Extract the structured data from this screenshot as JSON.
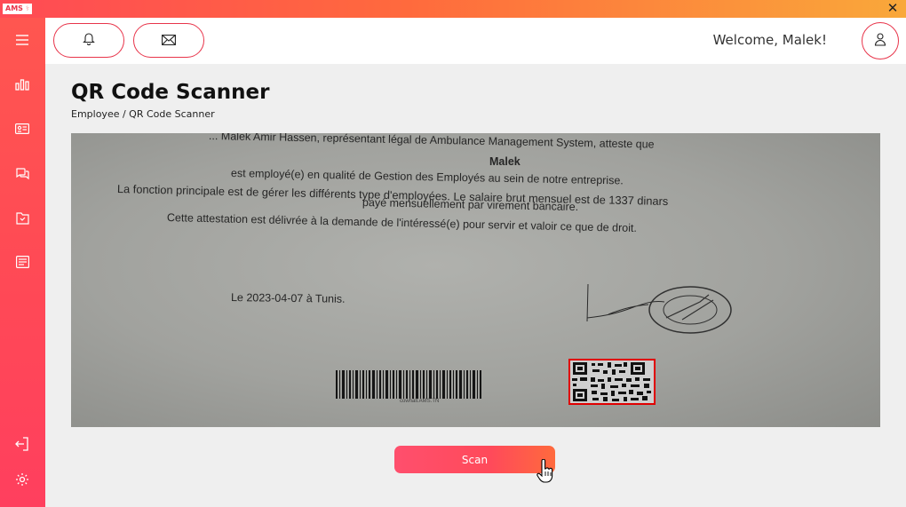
{
  "titlebar": {
    "logo_text": "AMS",
    "close_glyph": "✕"
  },
  "sidebar": {
    "items": [
      {
        "icon": "menu-icon"
      },
      {
        "icon": "chart-icon"
      },
      {
        "icon": "id-card-icon"
      },
      {
        "icon": "chat-icon"
      },
      {
        "icon": "folder-icon"
      },
      {
        "icon": "document-icon"
      },
      {
        "icon": "logout-icon"
      },
      {
        "icon": "gear-icon"
      }
    ]
  },
  "header": {
    "notification_icon": "bell-icon",
    "message_icon": "envelope-icon",
    "welcome_text": "Welcome, Malek!",
    "profile_icon": "user-icon"
  },
  "page": {
    "title": "QR Code Scanner",
    "breadcrumb": "Employee / QR Code Scanner"
  },
  "camera_view": {
    "lines": [
      "... Malek Amir Hassen, représentant légal de Ambulance Management System, atteste que",
      "Malek",
      "est employé(e) en qualité de Gestion des Employés au sein de notre entreprise.",
      "La fonction principale est de gérer les différents type d'employées. Le salaire brut mensuel est de 1337 dinars",
      "payé mensuellement par virement bancaire.",
      "Cette attestation est délivrée à la demande de l'intéressé(e) pour servir et valoir ce que de droit.",
      "Le 2023-04-07 à Tunis."
    ],
    "barcode_caption": "cowhall.AMS.TN"
  },
  "scan_button": {
    "label": "Scan"
  },
  "colors": {
    "accent": "#e8344a",
    "gradient_end": "#f9a83a"
  }
}
